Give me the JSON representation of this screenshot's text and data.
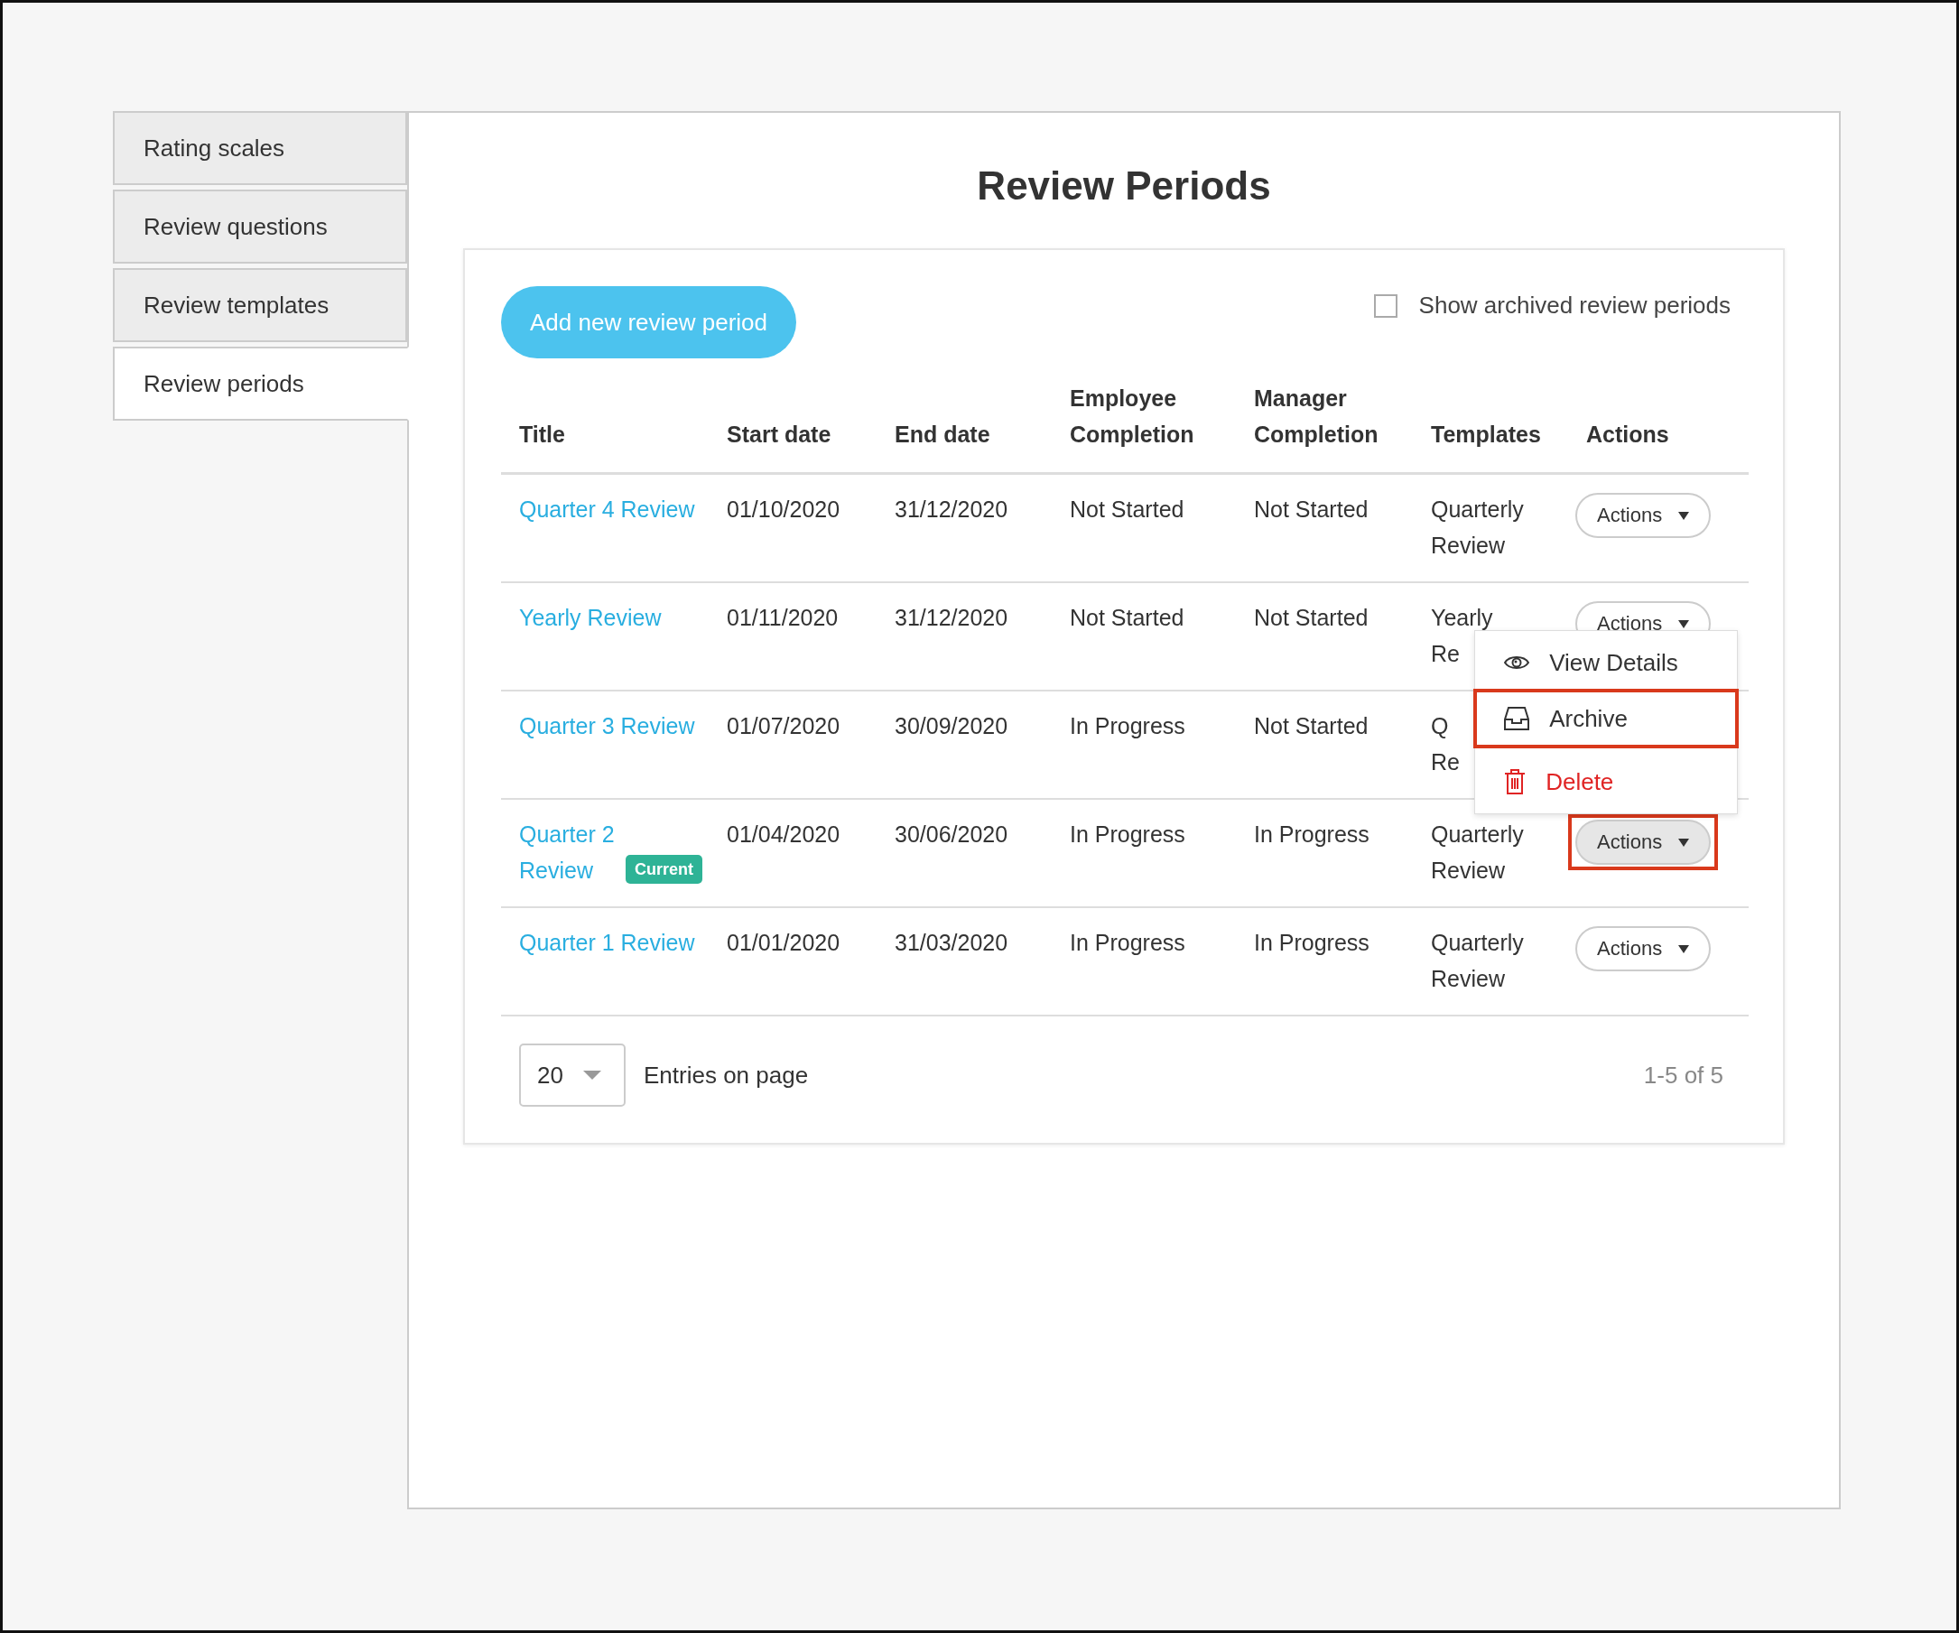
{
  "sidebar": {
    "tabs": [
      {
        "label": "Rating scales",
        "selected": false
      },
      {
        "label": "Review questions",
        "selected": false
      },
      {
        "label": "Review templates",
        "selected": false
      },
      {
        "label": "Review periods",
        "selected": true
      }
    ]
  },
  "page_title": "Review Periods",
  "add_button": "Add new review period",
  "show_archived": {
    "label": "Show archived review periods",
    "checked": false
  },
  "table": {
    "columns": [
      "Title",
      "Start date",
      "End date",
      "Employee Completion",
      "Manager Completion",
      "Templates",
      "Actions"
    ],
    "rows": [
      {
        "title": "Quarter 4 Review",
        "start": "01/10/2020",
        "end": "31/12/2020",
        "employee": "Not Started",
        "manager": "Not Started",
        "templates": "Quarterly Review",
        "actions": "Actions",
        "pressed": false,
        "highlighted": false
      },
      {
        "title": "Yearly Review",
        "start": "01/11/2020",
        "end": "31/12/2020",
        "employee": "Not Started",
        "manager": "Not Started",
        "templates": "Yearly Re",
        "actions": "Actions",
        "pressed": false,
        "highlighted": false
      },
      {
        "title": "Quarter 3 Review",
        "start": "01/07/2020",
        "end": "30/09/2020",
        "employee": "In Progress",
        "manager": "Not Started",
        "templates": "Q Re",
        "highlighted": false
      },
      {
        "title": "Quarter 2 Review",
        "badge": "Current",
        "start": "01/04/2020",
        "end": "30/06/2020",
        "employee": "In Progress",
        "manager": "In Progress",
        "templates": "Quarterly Review",
        "actions": "Actions",
        "pressed": true,
        "highlighted": true,
        "menu": [
          {
            "kind": "view",
            "label": "View Details",
            "highlighted": false
          },
          {
            "kind": "archive",
            "label": "Archive",
            "highlighted": true
          },
          {
            "kind": "delete",
            "label": "Delete",
            "highlighted": false
          }
        ]
      },
      {
        "title": "Quarter 1 Review",
        "start": "01/01/2020",
        "end": "31/03/2020",
        "employee": "In Progress",
        "manager": "In Progress",
        "templates": "Quarterly Review",
        "actions": "Actions",
        "pressed": false,
        "highlighted": false
      }
    ]
  },
  "pagination": {
    "page_size": "20",
    "page_size_label": "Entries on page",
    "range": "1-5 of 5"
  }
}
